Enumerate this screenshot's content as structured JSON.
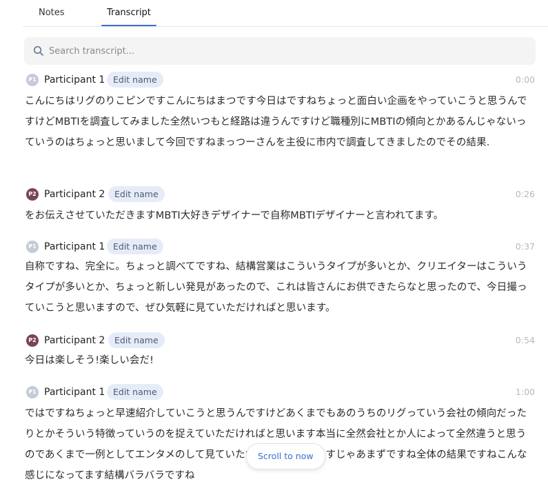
{
  "tabs": {
    "notes": "Notes",
    "transcript": "Transcript"
  },
  "search": {
    "placeholder": "Search transcript..."
  },
  "edit_label": "Edit name",
  "segments": [
    {
      "initials": "P1",
      "speaker": "Participant 1",
      "time": "0:00",
      "text": "こんにちはリグのりこピンですこんにちはまつです今日はですねちょっと面白い企画をやっていこうと思うんですけどMBTIを調査してみました全然いつもと経路は違うんですけど職種別にMBTIの傾向とかあるんじゃないっていうのはちょっと思いまして今回ですねまっつーさんを主役に市内で調査してきましたのでその結果."
    },
    {
      "initials": "P2",
      "speaker": "Participant 2",
      "time": "0:26",
      "text": "をお伝えさせていただきますMBTI大好きデザイナーで自称MBTIデザイナーと言われてます。"
    },
    {
      "initials": "P1",
      "speaker": "Participant 1",
      "time": "0:37",
      "text": "自称ですね、完全に。ちょっと調べてですね、結構営業はこういうタイプが多いとか、クリエイターはこういうタイプが多いとか、ちょっと新しい発見があったので、これは皆さんにお供できたらなと思ったので、今日撮っていこうと思いますので、ぜひ気軽に見ていただければと思います。"
    },
    {
      "initials": "P2",
      "speaker": "Participant 2",
      "time": "0:54",
      "text": "今日は楽しそう!楽しい会だ!"
    },
    {
      "initials": "P1",
      "speaker": "Participant 1",
      "time": "1:00",
      "text": "ではですねちょっと早速紹介していこうと思うんですけどあくまでもあのうちのリグっていう会社の傾向だったりとかそういう特徴っていうのを捉えていただければと思います本当に全然会社とか人によって全然違うと思うのであくまで一例としてエンタメのして見ていただければと思いますじゃあまずですね全体の結果ですねこんな感じになってます結構バラバラですね"
    }
  ],
  "scroll_button": "Scroll to now"
}
